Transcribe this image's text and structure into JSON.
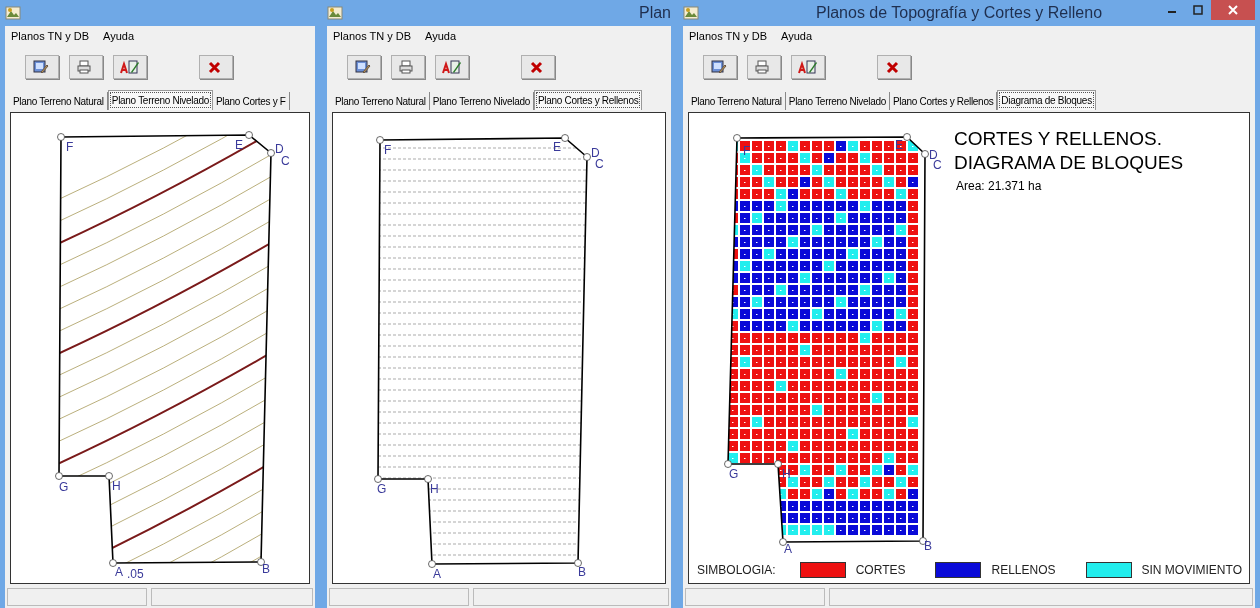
{
  "windows": [
    {
      "kind": "contours",
      "menu": [
        "Planos TN y DB",
        "Ayuda"
      ],
      "tabs": [
        {
          "label": "Plano Terreno Natural",
          "selected": false
        },
        {
          "label": "Plano Terreno Nivelado",
          "selected": true
        },
        {
          "label": "Plano Cortes y F",
          "selected": false
        }
      ],
      "plot": {
        "vertices": [
          "F",
          "E",
          "D",
          "C",
          "G",
          "H",
          "A",
          "B"
        ],
        "contour_label": ".05"
      }
    },
    {
      "kind": "levels",
      "title": "Plan",
      "menu": [
        "Planos TN y DB",
        "Ayuda"
      ],
      "tabs": [
        {
          "label": "Plano Terreno Natural",
          "selected": false
        },
        {
          "label": "Plano Terreno Nivelado",
          "selected": false
        },
        {
          "label": "Plano Cortes y Rellenos",
          "selected": true
        }
      ],
      "plot": {
        "vertices": [
          "F",
          "E",
          "D",
          "C",
          "G",
          "H",
          "A",
          "B"
        ]
      }
    },
    {
      "kind": "blocks",
      "title": "Planos de Topografía y Cortes y Relleno",
      "window_controls": true,
      "menu": [
        "Planos TN y DB",
        "Ayuda"
      ],
      "tabs": [
        {
          "label": "Plano Terreno Natural",
          "selected": false
        },
        {
          "label": "Plano Terreno Nivelado",
          "selected": false
        },
        {
          "label": "Plano Cortes y Rellenos",
          "selected": false
        },
        {
          "label": "Diagrama de Bloques",
          "selected": true
        }
      ],
      "plot": {
        "vertices": [
          "F",
          "E",
          "D",
          "C",
          "G",
          "H",
          "A",
          "B"
        ],
        "heading": [
          "CORTES Y RELLENOS.",
          "DIAGRAMA DE BLOQUES"
        ],
        "area": "Area: 21.371 ha",
        "legend": {
          "title": "SIMBOLOGIA:",
          "items": [
            {
              "label": "CORTES",
              "color": "#ee1111"
            },
            {
              "label": "RELLENOS",
              "color": "#0a0ad8"
            },
            {
              "label": "SIN MOVIMIENTO",
              "color": "#22eeee"
            }
          ]
        }
      }
    }
  ]
}
